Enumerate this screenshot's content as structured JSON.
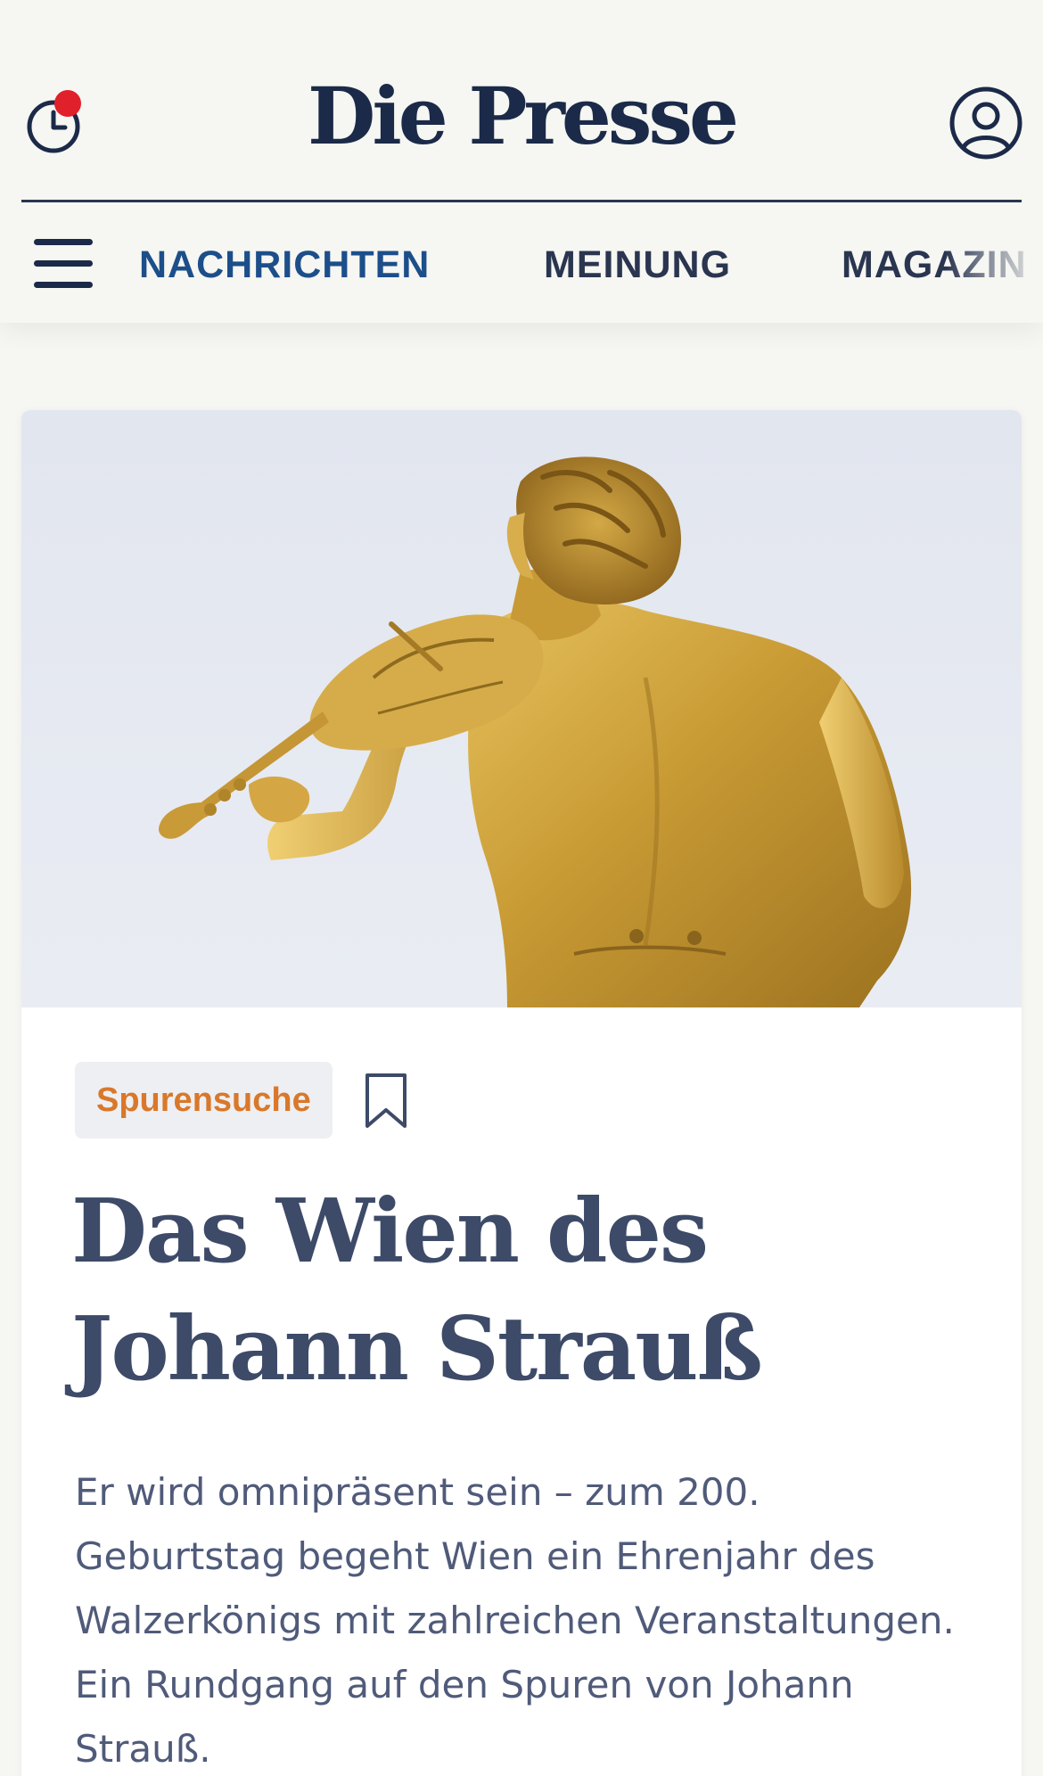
{
  "header": {
    "logo_text": "Die Presse",
    "history_icon": "clock-history-icon",
    "notification_color": "#e0202a",
    "account_icon": "user-account-icon",
    "menu_icon": "hamburger-menu-icon"
  },
  "nav": {
    "items": [
      {
        "label": "NACHRICHTEN",
        "active": true
      },
      {
        "label": "MEINUNG",
        "active": false
      },
      {
        "label": "MAGAZIN",
        "active": false
      }
    ]
  },
  "article": {
    "image_alt": "Goldene Statue von Johann Strauß mit Geige",
    "tag": "Spurensuche",
    "bookmark_icon": "bookmark-icon",
    "headline": "Das Wien des Johann Strauß",
    "lead": "Er wird omnipräsent sein – zum 200. Geburtstag begeht Wien ein Ehrenjahr des Walzerkönigs mit zahlreichen Veranstaltungen. Ein Rundgang auf den Spuren von Johann Strauß."
  },
  "colors": {
    "brand_navy": "#1b2a48",
    "nav_active": "#1c4f8a",
    "tag_text": "#d9782a",
    "page_background": "#f6f6f2"
  }
}
